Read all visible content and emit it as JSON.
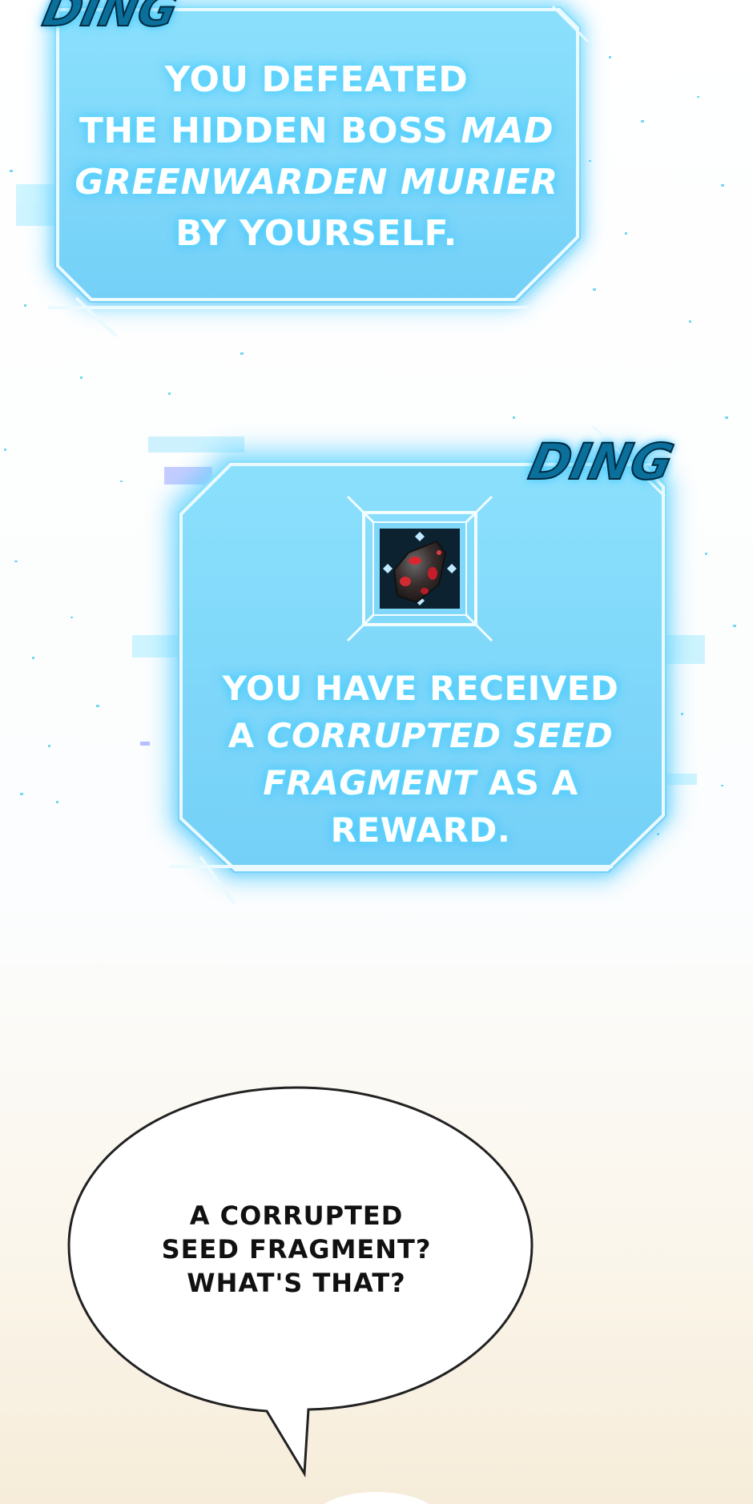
{
  "panel_top": {
    "sfx": "DING",
    "lines": [
      "YOU DEFEATED",
      "THE HIDDEN BOSS",
      "MAD",
      "GREENWARDEN MURIER",
      "BY YOURSELF."
    ]
  },
  "panel_reward": {
    "sfx": "DING",
    "item_icon": "corrupted-seed-fragment-icon",
    "lines": [
      "YOU HAVE RECEIVED",
      "A",
      "CORRUPTED SEED",
      "FRAGMENT",
      "AS A REWARD."
    ]
  },
  "speech_bubble": {
    "lines": [
      "A CORRUPTED",
      "SEED FRAGMENT?",
      "WHAT'S THAT?"
    ]
  },
  "colors": {
    "panel_fill": "#7fd8fa",
    "panel_glow": "#39c6ff",
    "panel_border": "#eafaff",
    "speech_stroke": "#222222"
  }
}
